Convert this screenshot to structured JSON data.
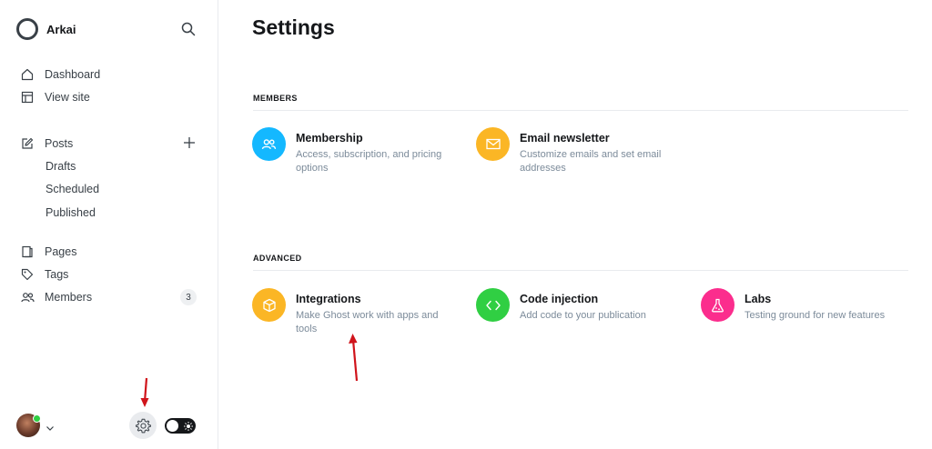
{
  "brand": {
    "name": "Arkai"
  },
  "nav": {
    "dashboard": "Dashboard",
    "view_site": "View site",
    "posts": "Posts",
    "drafts": "Drafts",
    "scheduled": "Scheduled",
    "published": "Published",
    "pages": "Pages",
    "tags": "Tags",
    "members": "Members",
    "members_count": "3"
  },
  "main": {
    "title": "Settings",
    "sections": [
      {
        "label": "MEMBERS",
        "items": [
          {
            "title": "Membership",
            "desc": [
              "Access, subscription, and pricing",
              "options"
            ],
            "icon": "members-icon",
            "color": "#14b8ff"
          },
          {
            "title": "Email newsletter",
            "desc": [
              "Customize emails and set email",
              "addresses"
            ],
            "icon": "mail-icon",
            "color": "#fbb625"
          }
        ]
      },
      {
        "label": "ADVANCED",
        "items": [
          {
            "title": "Integrations",
            "desc": [
              "Make Ghost work with apps and",
              "tools"
            ],
            "icon": "box-icon",
            "color": "#fbb625"
          },
          {
            "title": "Code injection",
            "desc": [
              "Add code to your publication"
            ],
            "icon": "code-icon",
            "color": "#30cf43"
          },
          {
            "title": "Labs",
            "desc": [
              "Testing ground for new features"
            ],
            "icon": "flask-icon",
            "color": "#fb2d8d"
          }
        ]
      }
    ]
  },
  "annotations": {
    "arrow_color": "#d0141b"
  }
}
